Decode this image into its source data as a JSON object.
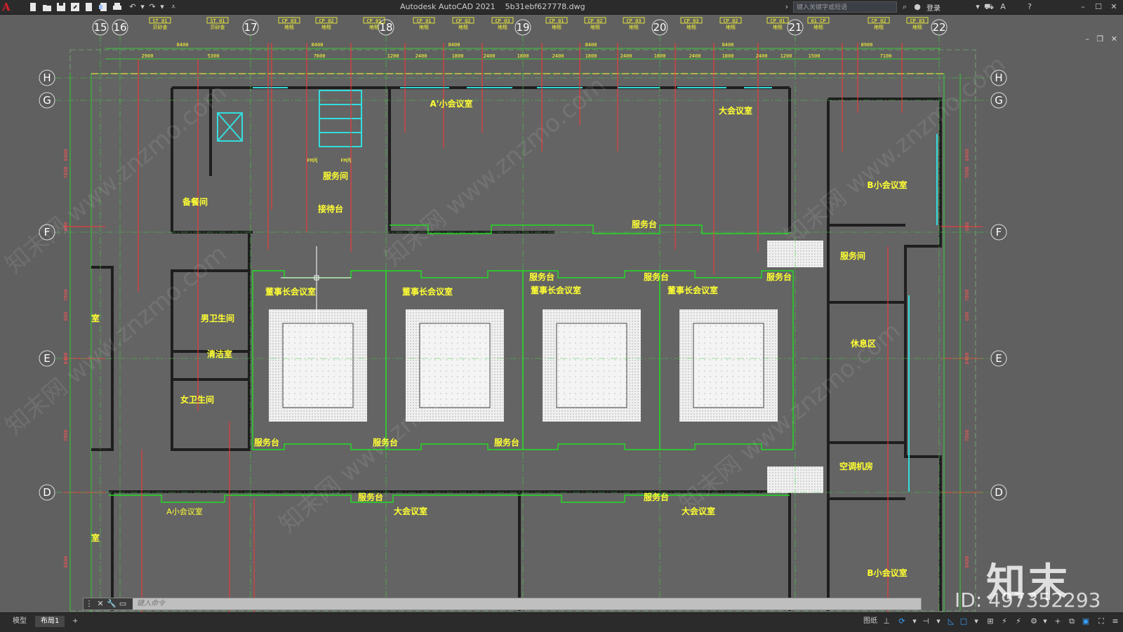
{
  "titlebar": {
    "app_title": "Autodesk AutoCAD 2021",
    "file_name": "5b31ebf627778.dwg",
    "search_placeholder": "键入关键字或短语",
    "login_label": "登录",
    "quick_access_icons": [
      "new-icon",
      "open-icon",
      "save-icon",
      "saveas-icon",
      "plot-icon",
      "publish-icon",
      "print-icon",
      "undo-icon",
      "redo-icon",
      "customize-icon"
    ]
  },
  "drawing": {
    "column_grid": [
      "15",
      "16",
      "17",
      "18",
      "19",
      "20",
      "21",
      "22"
    ],
    "row_grid": [
      "H",
      "G",
      "F",
      "E",
      "D"
    ],
    "top_dims": [
      "8400",
      "8400",
      "8400",
      "8400",
      "8400",
      "8900"
    ],
    "sub_dims": [
      "2900",
      "5300",
      "7600",
      "1200",
      "2400",
      "1800",
      "2400",
      "1800",
      "2400",
      "1800",
      "2400",
      "1800",
      "2400",
      "1800",
      "2400",
      "1200",
      "1500",
      "7100"
    ],
    "side_dims": [
      "8400",
      "7800",
      "600",
      "7800",
      "600",
      "8400",
      "7800",
      "8400"
    ],
    "column_tags": [
      "ST 01",
      "ST 01",
      "CP 03",
      "CP 02",
      "CP 01",
      "CP 01",
      "CP 02",
      "CP 03",
      "CP 01",
      "CP 02",
      "CP 03",
      "CP 03",
      "CP 02",
      "CP 01",
      "01 CP",
      "CP 02",
      "CP 03"
    ],
    "tag_sub": [
      "贝砂金",
      "贝砂金",
      "地毯",
      "地毯",
      "地毯",
      "地毯",
      "地毯",
      "地毯",
      "地毯",
      "地毯",
      "地毯",
      "地毯",
      "地毯",
      "地毯",
      "地毯",
      "地毯",
      "地毯"
    ],
    "rooms": {
      "a_small_meeting": "A'小会议室",
      "big_meeting_top": "大会议室",
      "service_room": "服务间",
      "storage": "备餐间",
      "reception": "接待台",
      "service_desk_top": "服务台",
      "b_small_meeting": "B小会议室",
      "service_room_right": "服务间",
      "service_desk_1": "服务台",
      "service_desk_2": "服务台",
      "service_desk_3": "服务台",
      "long_table_1": "董事长会议室",
      "long_table_2": "董事长会议室",
      "long_table_3": "董事长会议室",
      "long_table_4": "董事长会议室",
      "male_wc": "男卫生间",
      "cleaning": "清洁室",
      "female_wc": "女卫生间",
      "lounge": "休息区",
      "ac_room": "空调机房",
      "desk_bot_1": "服务台",
      "desk_bot_2": "服务台",
      "desk_bot_3": "服务台",
      "desk_bot_4": "服务台",
      "desk_bot_5": "服务台",
      "a_small_meeting_bot": "A小会议室",
      "big_meeting_bot_1": "大会议室",
      "big_meeting_bot_2": "大会议室",
      "b_small_meeting_bot": "B小会议室",
      "room_left_1": "室",
      "room_left_2": "室",
      "fm1": "FM丙",
      "fm2": "FM丙"
    },
    "watermark": "知末网 www.znzmo.com"
  },
  "stamps": {
    "brand": "知末",
    "id": "ID: 497352293"
  },
  "cmdline": {
    "placeholder": "键入命令"
  },
  "statusbar": {
    "tabs": [
      "模型",
      "布局1"
    ],
    "paper_label": "图纸",
    "icons": [
      "grid-icon",
      "snap-icon",
      "ortho-icon",
      "polar-icon",
      "osnap-icon",
      "otrack-icon",
      "lineweight-icon",
      "annotation-icon",
      "workspace-icon",
      "settings-icon",
      "isolate-icon",
      "fullscreen-icon",
      "customize-status-icon"
    ]
  }
}
